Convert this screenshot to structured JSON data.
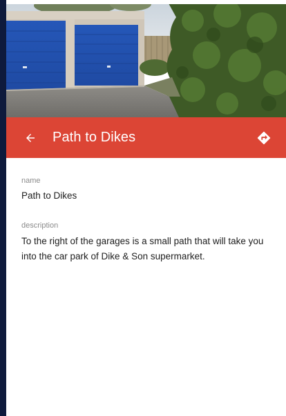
{
  "header": {
    "title": "Path to Dikes",
    "back_icon": "arrow-left-icon",
    "directions_icon": "directions-icon"
  },
  "photo": {
    "subject": "blue garage doors beside a hedge"
  },
  "fields": {
    "name_label": "name",
    "name_value": "Path to Dikes",
    "description_label": "description",
    "description_value": "To the right of the garages is a small path that will take you into the car park of Dike & Son supermarket."
  },
  "colors": {
    "app_bar": "#dc4535",
    "left_strip": "#0e1a3c",
    "label_text": "#8a8a8a",
    "value_text": "#1d1d1d"
  }
}
